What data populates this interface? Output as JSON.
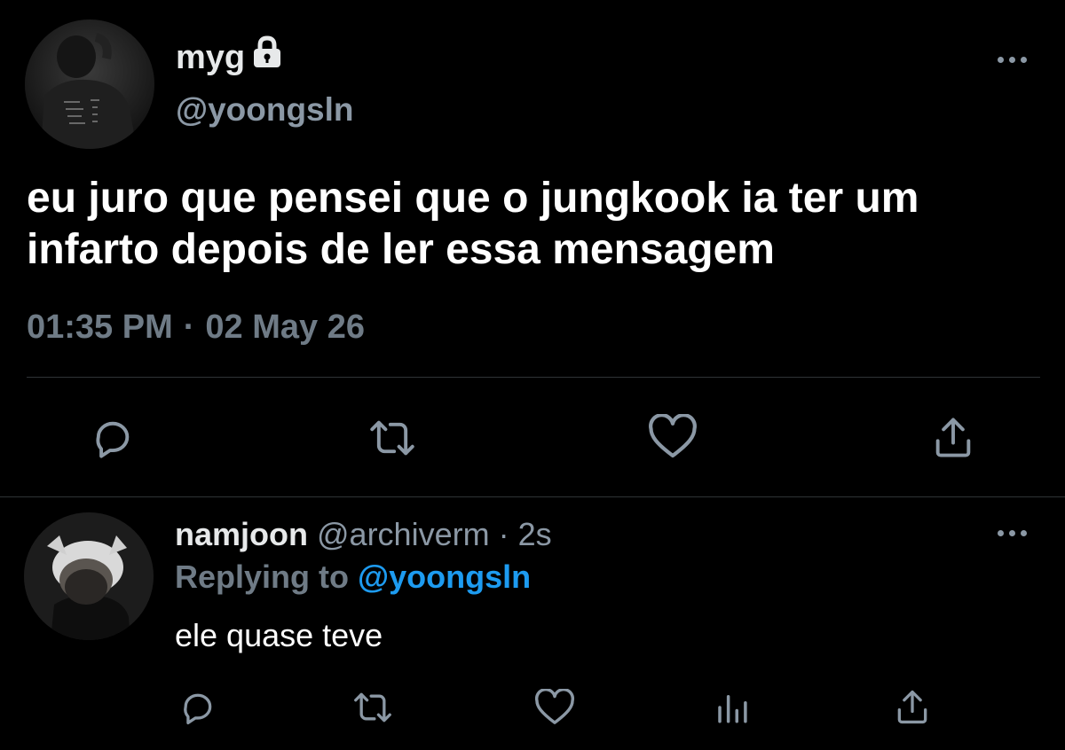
{
  "main_tweet": {
    "display_name": "myg",
    "handle": "@yoongsln",
    "text": "eu juro que pensei que o jungkook ia ter um infarto depois de ler essa mensagem",
    "time": "01:35 PM",
    "separator": "·",
    "date": "02 May 26",
    "icons": [
      "lock-icon",
      "more-icon",
      "reply-icon",
      "retweet-icon",
      "like-icon",
      "share-icon"
    ]
  },
  "reply": {
    "display_name": "namjoon",
    "handle": "@archiverm",
    "separator": "·",
    "time": "2s",
    "replying_prefix": "Replying to",
    "replying_handle": "@yoongsln",
    "text": "ele quase teve",
    "icons": [
      "reply-icon",
      "retweet-icon",
      "like-icon",
      "analytics-icon",
      "share-icon"
    ]
  },
  "colors": {
    "background": "#000000",
    "text_primary": "#ffffff",
    "text_secondary": "#8b98a5",
    "link": "#1d9bf0",
    "divider": "#2f3336"
  }
}
